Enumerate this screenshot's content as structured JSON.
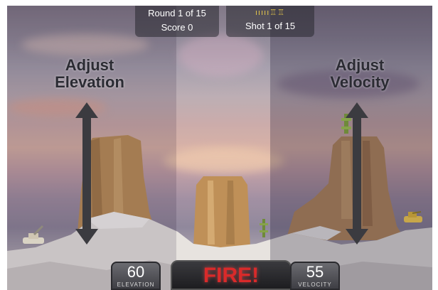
{
  "hud": {
    "round_text": "Round 1 of 15",
    "score_text": "Score 0",
    "shot_text": "Shot 1 of 15",
    "ammo_icons": "ııııı♖♖"
  },
  "hints": {
    "elevation_line1": "Adjust",
    "elevation_line2": "Elevation",
    "velocity_line1": "Adjust",
    "velocity_line2": "Velocity"
  },
  "controls": {
    "elevation_value": "60",
    "elevation_label": "ELEVATION",
    "velocity_value": "55",
    "velocity_label": "VELOCITY",
    "fire_label": "FIRE!"
  },
  "colors": {
    "fire_text": "#d92a2a",
    "hud_bg": "#2a2a30",
    "arrow": "#3b3b40"
  }
}
